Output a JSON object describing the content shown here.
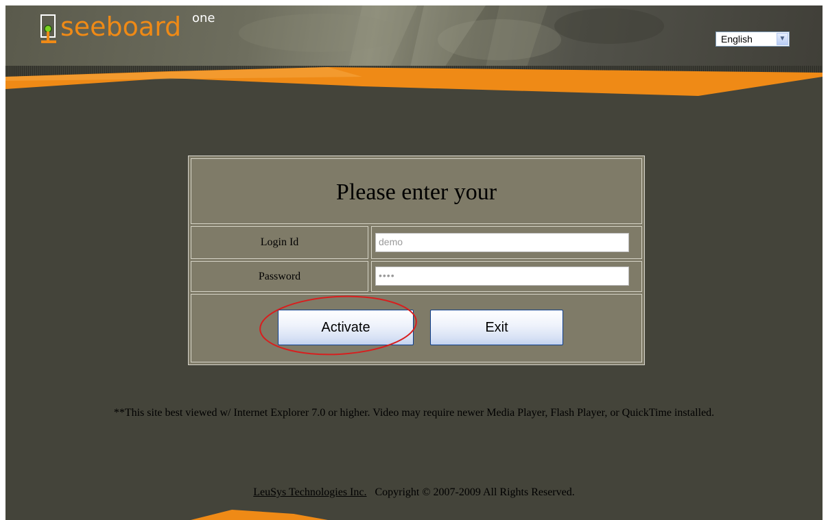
{
  "header": {
    "logo_word": "seeboard",
    "logo_superscript": "one",
    "language_selected": "English"
  },
  "login": {
    "title": "Please enter your",
    "login_label": "Login Id",
    "login_value": "demo",
    "password_label": "Password",
    "password_value": "••••",
    "activate_label": "Activate",
    "exit_label": "Exit"
  },
  "note": "**This site best viewed w/ Internet Explorer 7.0 or higher. Video may require newer Media Player, Flash Player, or QuickTime installed.",
  "footer": {
    "company_link": "LeuSys Technologies Inc.",
    "copyright": "Copyright © 2007-2009 All Rights Reserved."
  },
  "colors": {
    "brand_orange": "#ef8a16",
    "background": "#44443a",
    "panel": "#7f7b68",
    "highlight_circle": "#d81e1e"
  }
}
